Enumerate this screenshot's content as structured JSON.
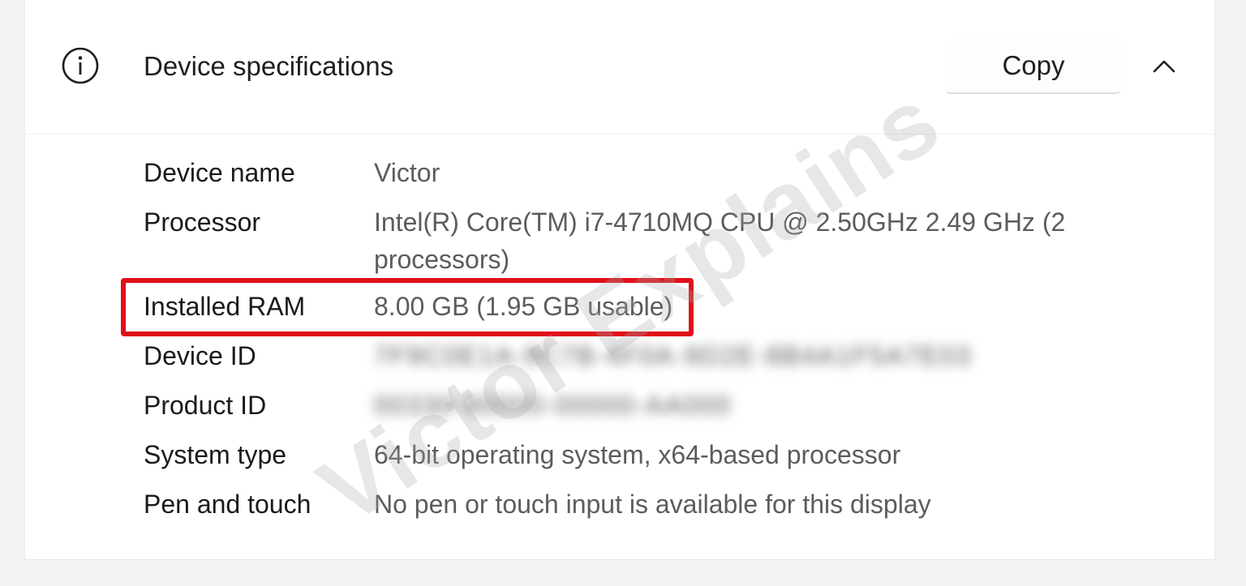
{
  "header": {
    "title": "Device specifications",
    "copy_label": "Copy",
    "icon": "info-icon",
    "collapse_icon": "chevron-up-icon"
  },
  "specs": [
    {
      "label": "Device name",
      "value": "Victor"
    },
    {
      "label": "Processor",
      "value": "Intel(R) Core(TM) i7-4710MQ CPU @ 2.50GHz   2.49 GHz  (2 processors)"
    },
    {
      "label": "Installed RAM",
      "value": "8.00 GB (1.95 GB usable)"
    },
    {
      "label": "Device ID",
      "value": "7F9C0E1A-9C7B-4F0A-9D2E-8B4A1F5A7E03"
    },
    {
      "label": "Product ID",
      "value": "00330-80000-00000-AA000"
    },
    {
      "label": "System type",
      "value": "64-bit operating system, x64-based processor"
    },
    {
      "label": "Pen and touch",
      "value": "No pen or touch input is available for this display"
    }
  ],
  "watermark": "Victor Explains",
  "colors": {
    "highlight": "#e0101a",
    "label_text": "#1a1a1a",
    "value_text": "#5c5c5c"
  }
}
